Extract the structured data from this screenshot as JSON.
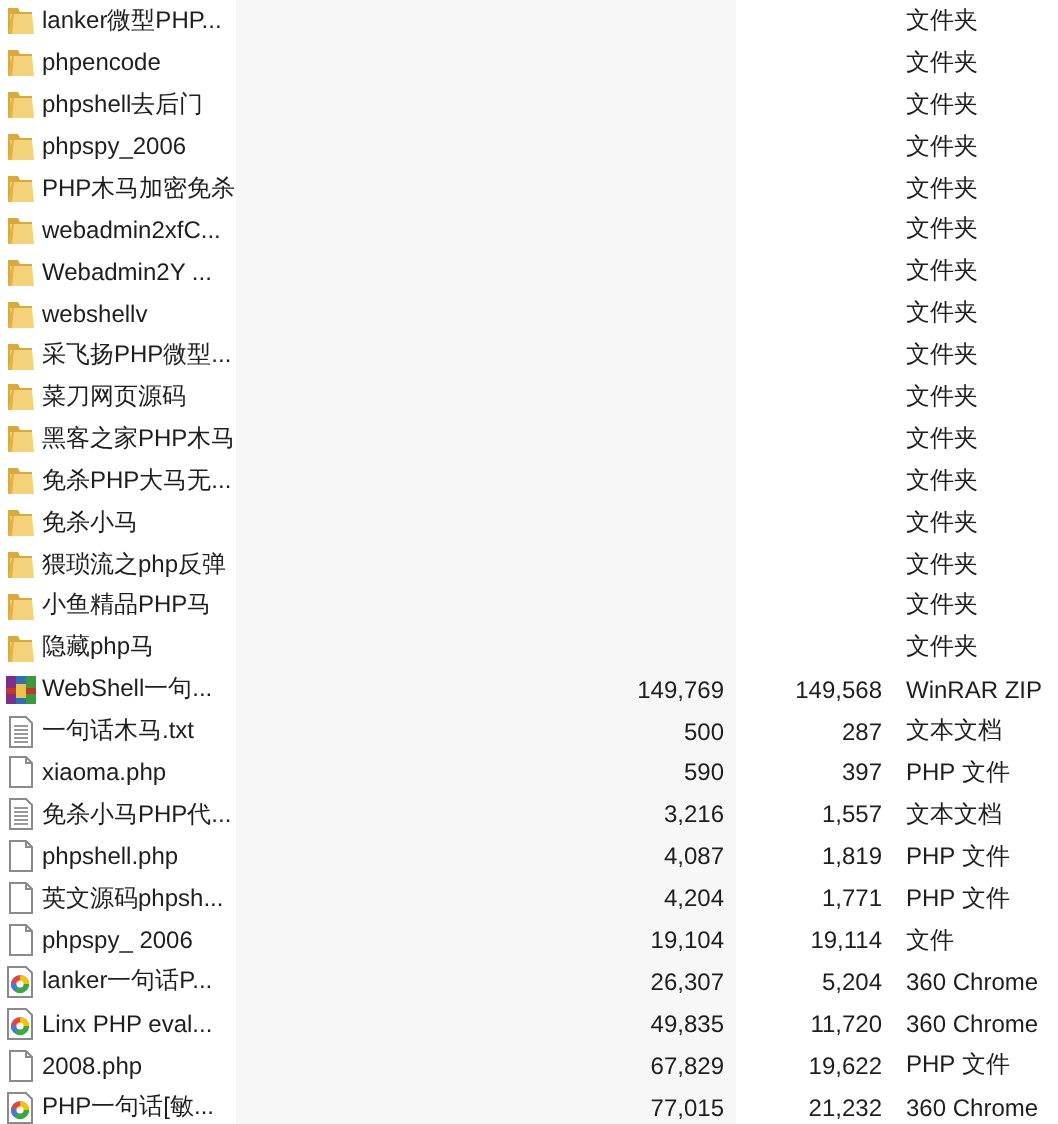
{
  "files": [
    {
      "kind": "folder",
      "name": "lanker微型PHP...",
      "type": "文件夹"
    },
    {
      "kind": "folder",
      "name": "phpencode",
      "type": "文件夹"
    },
    {
      "kind": "folder",
      "name": "phpshell去后门",
      "type": "文件夹"
    },
    {
      "kind": "folder",
      "name": "phpspy_2006",
      "type": "文件夹"
    },
    {
      "kind": "folder",
      "name": "PHP木马加密免杀",
      "type": "文件夹"
    },
    {
      "kind": "folder",
      "name": "webadmin2xfC...",
      "type": "文件夹"
    },
    {
      "kind": "folder",
      "name": "Webadmin2Y ...",
      "type": "文件夹"
    },
    {
      "kind": "folder",
      "name": "webshellv",
      "type": "文件夹"
    },
    {
      "kind": "folder",
      "name": "采飞扬PHP微型...",
      "type": "文件夹"
    },
    {
      "kind": "folder",
      "name": "菜刀网页源码",
      "type": "文件夹"
    },
    {
      "kind": "folder",
      "name": "黑客之家PHP木马",
      "type": "文件夹"
    },
    {
      "kind": "folder",
      "name": "免杀PHP大马无...",
      "type": "文件夹"
    },
    {
      "kind": "folder",
      "name": "免杀小马",
      "type": "文件夹"
    },
    {
      "kind": "folder",
      "name": "猥琐流之php反弹",
      "type": "文件夹"
    },
    {
      "kind": "folder",
      "name": "小鱼精品PHP马",
      "type": "文件夹"
    },
    {
      "kind": "folder",
      "name": "隐藏php马",
      "type": "文件夹"
    },
    {
      "kind": "archive",
      "name": "WebShell一句...",
      "size": "149,769",
      "packed": "149,568",
      "type": "WinRAR ZIP"
    },
    {
      "kind": "text",
      "name": "一句话木马.txt",
      "size": "500",
      "packed": "287",
      "type": "文本文档"
    },
    {
      "kind": "file",
      "name": "xiaoma.php",
      "size": "590",
      "packed": "397",
      "type": "PHP 文件"
    },
    {
      "kind": "text",
      "name": "免杀小马PHP代...",
      "size": "3,216",
      "packed": "1,557",
      "type": "文本文档"
    },
    {
      "kind": "file",
      "name": "phpshell.php",
      "size": "4,087",
      "packed": "1,819",
      "type": "PHP 文件"
    },
    {
      "kind": "file",
      "name": "英文源码phpsh...",
      "size": "4,204",
      "packed": "1,771",
      "type": "PHP 文件"
    },
    {
      "kind": "file",
      "name": "phpspy_ 2006",
      "size": "19,104",
      "packed": "19,114",
      "type": "文件"
    },
    {
      "kind": "web",
      "name": "lanker一句话P...",
      "size": "26,307",
      "packed": "5,204",
      "type": "360 Chrome"
    },
    {
      "kind": "web",
      "name": "Linx PHP eval...",
      "size": "49,835",
      "packed": "11,720",
      "type": "360 Chrome"
    },
    {
      "kind": "file",
      "name": "2008.php",
      "size": "67,829",
      "packed": "19,622",
      "type": "PHP 文件"
    },
    {
      "kind": "web",
      "name": "PHP一句话[敏...",
      "size": "77,015",
      "packed": "21,232",
      "type": "360 Chrome"
    }
  ]
}
